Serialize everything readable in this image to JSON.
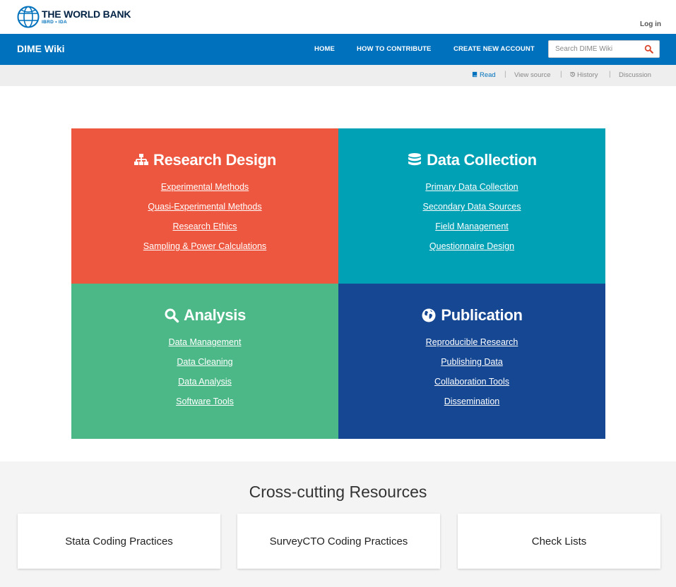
{
  "header": {
    "logo_title": "THE WORLD BANK",
    "logo_subtitle": "IBRD • IDA",
    "login_label": "Log in"
  },
  "nav": {
    "site_title": "DIME Wiki",
    "links": [
      "HOME",
      "HOW TO CONTRIBUTE",
      "CREATE NEW ACCOUNT"
    ],
    "search_placeholder": "Search DIME Wiki"
  },
  "page_actions": [
    "Read",
    "View source",
    "History",
    "Discussion"
  ],
  "tiles": [
    {
      "title": "Research Design",
      "icon": "sitemap-icon",
      "color": "#ee573f",
      "links": [
        "Experimental Methods",
        "Quasi-Experimental Methods",
        "Research Ethics",
        "Sampling & Power Calculations"
      ]
    },
    {
      "title": "Data Collection",
      "icon": "database-icon",
      "color": "#00a0b5",
      "links": [
        "Primary Data Collection",
        "Secondary Data Sources",
        "Field Management",
        "Questionnaire Design"
      ]
    },
    {
      "title": "Analysis",
      "icon": "search-icon",
      "color": "#4db887",
      "links": [
        "Data Management",
        "Data Cleaning",
        "Data Analysis",
        "Software Tools"
      ]
    },
    {
      "title": "Publication",
      "icon": "globe-icon",
      "color": "#154793",
      "links": [
        "Reproducible Research",
        "Publishing Data",
        "Collaboration Tools",
        "Dissemination"
      ]
    }
  ],
  "resources": {
    "title": "Cross-cutting Resources",
    "cards": [
      "Stata Coding Practices",
      "SurveyCTO Coding Practices",
      "Check Lists"
    ]
  },
  "colors": {
    "brand_blue": "#0071bc",
    "subbar_grey": "#eeeeee",
    "search_icon_red": "#d9452a"
  }
}
